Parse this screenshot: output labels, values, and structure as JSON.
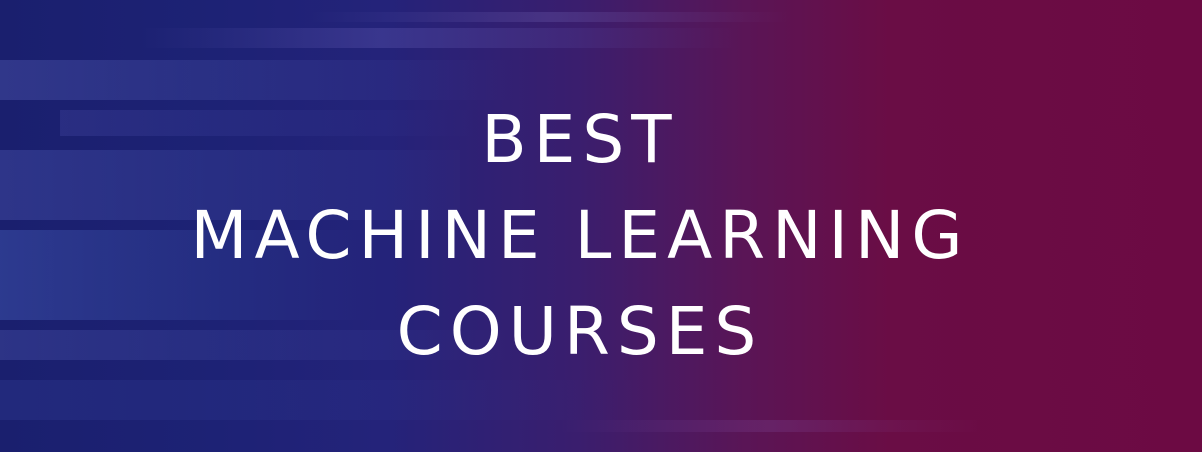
{
  "banner": {
    "lines": [
      "BEST",
      "MACHINE LEARNING",
      "COURSES"
    ],
    "colors": {
      "left": "#1a1f6e",
      "right": "#6c0a43",
      "text": "#ffffff"
    }
  }
}
